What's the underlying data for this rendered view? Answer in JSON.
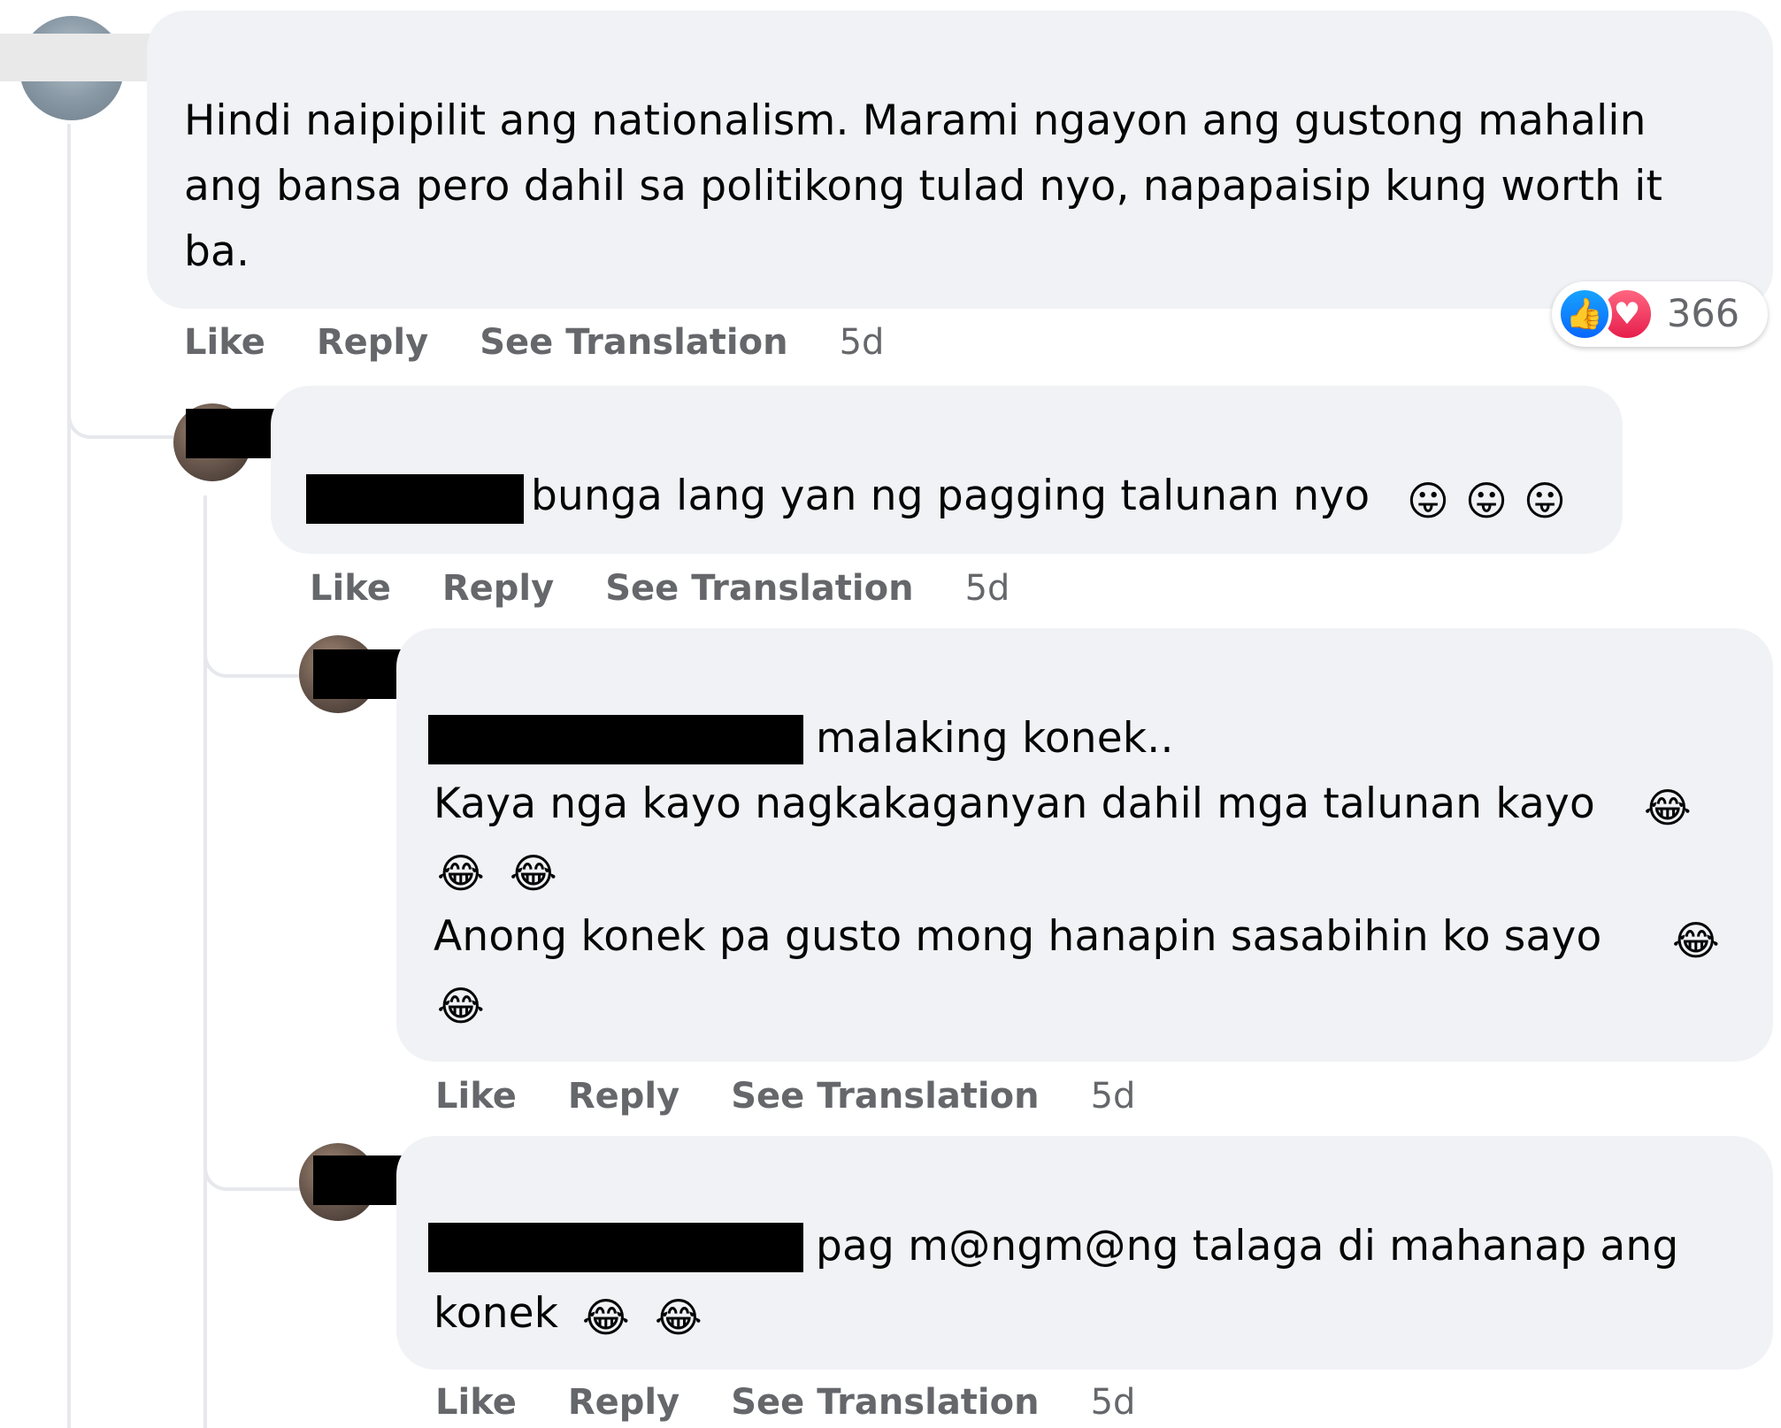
{
  "comments": [
    {
      "lines": [
        "Hindi naipipilit ang nationalism. Marami ngayon ang gustong mahalin",
        "ang bansa pero dahil sa politikong tulad nyo, napapaisip kung worth it",
        "ba."
      ],
      "reaction_count": "366",
      "reaction_icons": [
        "like-icon",
        "love-icon"
      ],
      "actions": {
        "like": "Like",
        "reply": "Reply",
        "see_translation": "See Translation",
        "time": "5d"
      }
    },
    {
      "lines": [
        "bunga lang yan ng pagging talunan nyo"
      ],
      "emojis": [
        "😛",
        "😛",
        "😛"
      ],
      "actions": {
        "like": "Like",
        "reply": "Reply",
        "see_translation": "See Translation",
        "time": "5d"
      }
    },
    {
      "lines": [
        "malaking konek..",
        "Kaya nga kayo nagkakaganyan dahil mga talunan kayo",
        "Anong konek pa gusto mong hanapin sasabihin ko sayo"
      ],
      "emoji": "😂",
      "actions": {
        "like": "Like",
        "reply": "Reply",
        "see_translation": "See Translation",
        "time": "5d"
      }
    },
    {
      "lines": [
        "pag m@ngm@ng talaga di mahanap ang",
        "konek"
      ],
      "emoji": "😂",
      "actions": {
        "like": "Like",
        "reply": "Reply",
        "see_translation": "See Translation",
        "time": "5d"
      }
    }
  ]
}
